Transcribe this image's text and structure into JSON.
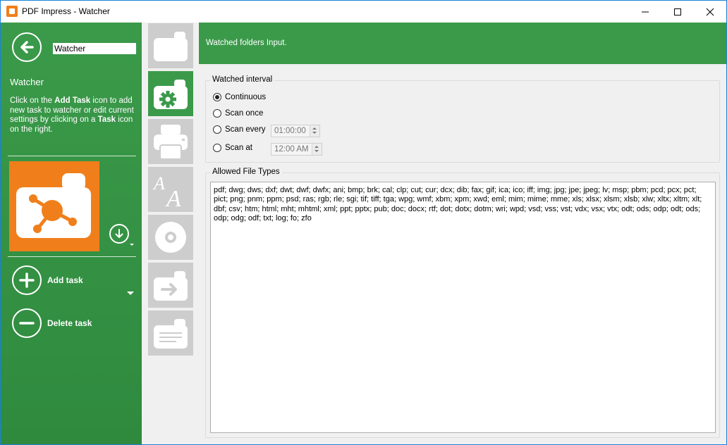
{
  "window": {
    "title": "PDF Impress - Watcher"
  },
  "sidebar": {
    "name_value": "Watcher",
    "title": "Watcher",
    "help": {
      "p1": "Click on the ",
      "b1": "Add Task",
      "p2": " icon to add new task to watcher or edit current settings by clicking on a ",
      "b2": "Task",
      "p3": " icon on the right."
    },
    "add_task_label": "Add task",
    "delete_task_label": "Delete task"
  },
  "header": {
    "text": "Watched folders Input."
  },
  "watched_interval": {
    "legend": "Watched interval",
    "options": [
      {
        "label": "Continuous",
        "checked": true
      },
      {
        "label": "Scan once",
        "checked": false
      },
      {
        "label": "Scan every",
        "checked": false,
        "value": "01:00:00"
      },
      {
        "label": "Scan at",
        "checked": false,
        "value": "12:00 AM"
      }
    ]
  },
  "allowed_file_types": {
    "legend": "Allowed File Types",
    "value": "pdf; dwg; dws; dxf; dwt; dwf; dwfx; ani; bmp; brk; cal; clp; cut; cur; dcx; dib; fax; gif; ica; ico; iff; img; jpg; jpe; jpeg; lv; msp; pbm; pcd; pcx; pct; pict; png; pnm; ppm; psd; ras; rgb; rle; sgi; tif; tiff; tga; wpg; wmf; xbm; xpm; xwd; eml; mim; mime; mme; xls; xlsx; xlsm; xlsb; xlw; xltx; xltm; xlt; dbf; csv; htm; html; mht; mhtml; xml; ppt; pptx; pub; doc; docx; rtf; dot; dotx; dotm; wri; wpd; vsd; vss; vst; vdx; vsx; vtx; odt; ods; odp; odt; ods; odp; odg; odf; txt; log; fo; zfo"
  },
  "colors": {
    "accent_green": "#3b9a4a",
    "task_orange": "#f07f1b",
    "inactive_tile": "#cdcdcd"
  }
}
